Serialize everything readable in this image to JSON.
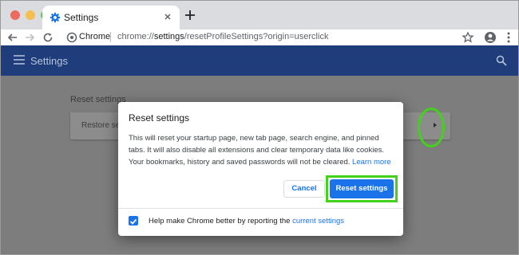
{
  "browser": {
    "tab_title": "Settings",
    "omnibox": {
      "site_label": "Chrome",
      "url_prefix": "chrome://",
      "url_bold": "settings",
      "url_rest": "/resetProfileSettings?origin=userclick"
    }
  },
  "settings_header": {
    "title": "Settings"
  },
  "page": {
    "section_title": "Reset settings",
    "card_label": "Restore se"
  },
  "dialog": {
    "title": "Reset settings",
    "body_text": "This will reset your startup page, new tab page, search engine, and pinned tabs. It will also disable all extensions and clear temporary data like cookies. Your bookmarks, history and saved passwords will not be cleared.",
    "learn_more": "Learn more",
    "cancel_label": "Cancel",
    "reset_label": "Reset settings",
    "checkbox_checked": true,
    "footer_text": "Help make Chrome better by reporting the",
    "footer_link": "current settings"
  },
  "colors": {
    "header_bg": "#1f3d7a",
    "accent": "#1a73e8",
    "highlight": "#43d21c"
  },
  "icons": [
    "gear-icon",
    "close-icon",
    "plus-icon",
    "back-arrow-icon",
    "forward-arrow-icon",
    "reload-icon",
    "info-icon",
    "star-icon",
    "account-icon",
    "kebab-menu-icon",
    "hamburger-menu-icon",
    "search-icon",
    "chevron-right-icon",
    "checkmark-icon"
  ]
}
